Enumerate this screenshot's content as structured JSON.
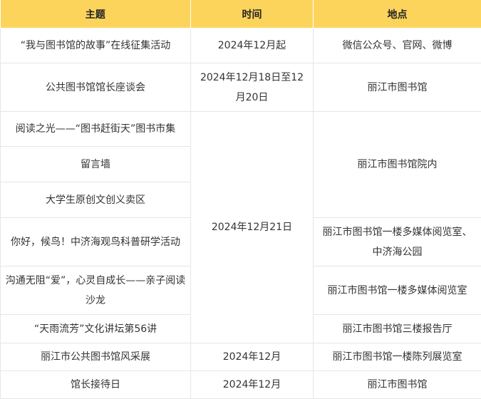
{
  "table": {
    "headers": [
      "主题",
      "时间",
      "地点"
    ],
    "rows": [
      {
        "topic": "“我与图书馆的故事”在线征集活动",
        "time": "2024年12月起",
        "place": "微信公众号、官网、微博"
      },
      {
        "topic": "公共图书馆馆长座谈会",
        "time": "2024年12月18日至12月20日",
        "place": "丽江市图书馆"
      },
      {
        "topic": "阅读之光——“图书赶街天”图书市集",
        "time": "2024年12月21日",
        "place": "丽江市图书馆院内"
      },
      {
        "topic": "留言墙"
      },
      {
        "topic": "大学生原创文创义卖区"
      },
      {
        "topic": "你好，候鸟！中济海观鸟科普研学活动",
        "place": "丽江市图书馆一楼多媒体阅览室、中济海公园"
      },
      {
        "topic": "沟通无阻“爱”，心灵自成长——亲子阅读沙龙",
        "place": "丽江市图书馆一楼多媒体阅览室"
      },
      {
        "topic": "“天雨流芳”文化讲坛第56讲",
        "place": "丽江市图书馆三楼报告厅"
      },
      {
        "topic": "丽江市公共图书馆风采展",
        "time": "2024年12月",
        "place": "丽江市图书馆一楼陈列展览室"
      },
      {
        "topic": "馆长接待日",
        "time": "2024年12月",
        "place": "丽江市图书馆"
      }
    ]
  }
}
